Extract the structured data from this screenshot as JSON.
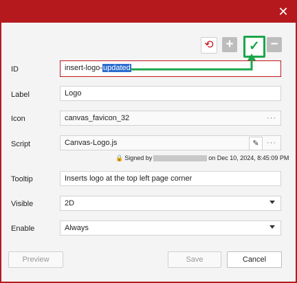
{
  "colors": {
    "accent": "#b5191e",
    "confirm": "#1aa64a",
    "selection": "#2b6ccf"
  },
  "window": {
    "close_icon": "close-icon"
  },
  "toolbar": {
    "undo_icon": "undo-icon",
    "add_icon": "plus-icon",
    "confirm_icon": "checkmark-icon",
    "remove_icon": "minus-icon"
  },
  "form": {
    "id": {
      "label": "ID",
      "value_prefix": "insert-logo-",
      "value_selected": "updated"
    },
    "label": {
      "label": "Label",
      "value": "Logo"
    },
    "icon": {
      "label": "Icon",
      "value": "canvas_favicon_32",
      "more": "···"
    },
    "script": {
      "label": "Script",
      "value": "Canvas-Logo.js",
      "edit_icon": "pencil-icon",
      "more": "···",
      "signed_prefix": "Signed by",
      "signed_suffix": "on Dec 10, 2024, 8:45:09 PM"
    },
    "tooltip": {
      "label": "Tooltip",
      "value": "Inserts logo at the top left page corner"
    },
    "visible": {
      "label": "Visible",
      "value": "2D"
    },
    "enable": {
      "label": "Enable",
      "value": "Always"
    }
  },
  "footer": {
    "preview": "Preview",
    "save": "Save",
    "cancel": "Cancel"
  }
}
